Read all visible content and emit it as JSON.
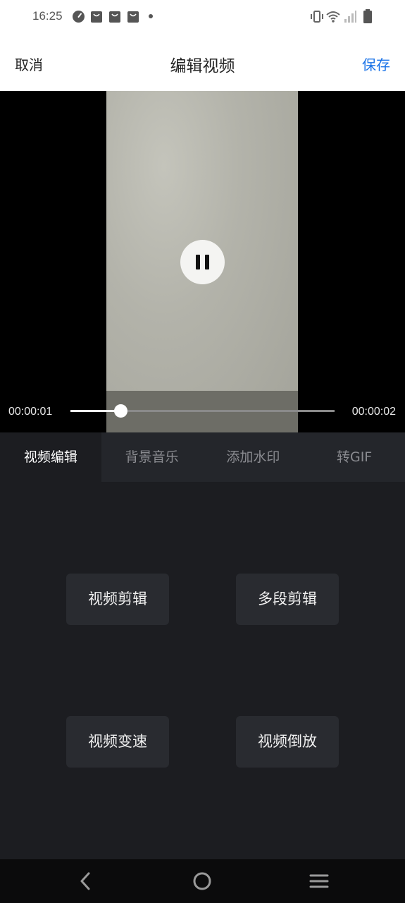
{
  "status_bar": {
    "time": "16:25",
    "left_icons": [
      "speedometer-icon",
      "shopping-bag-icon",
      "shopping-bag-icon",
      "shopping-bag-icon",
      "dot-icon"
    ],
    "right_icons": [
      "vibrate-icon",
      "wifi-icon",
      "signal-icon",
      "battery-icon"
    ]
  },
  "header": {
    "cancel_label": "取消",
    "title": "编辑视频",
    "save_label": "保存",
    "save_color": "#1a73e8"
  },
  "player": {
    "state_icon": "pause-icon",
    "current_time": "00:00:01",
    "total_time": "00:00:02",
    "progress": 0.19
  },
  "tabs": [
    {
      "label": "视频编辑",
      "active": true
    },
    {
      "label": "背景音乐",
      "active": false
    },
    {
      "label": "添加水印",
      "active": false
    },
    {
      "label": "转GIF",
      "active": false
    }
  ],
  "tools": [
    {
      "label": "视频剪辑"
    },
    {
      "label": "多段剪辑"
    },
    {
      "label": "视频变速"
    },
    {
      "label": "视频倒放"
    }
  ],
  "nav_bar": {
    "icons": [
      "back-icon",
      "home-icon",
      "menu-icon"
    ]
  }
}
